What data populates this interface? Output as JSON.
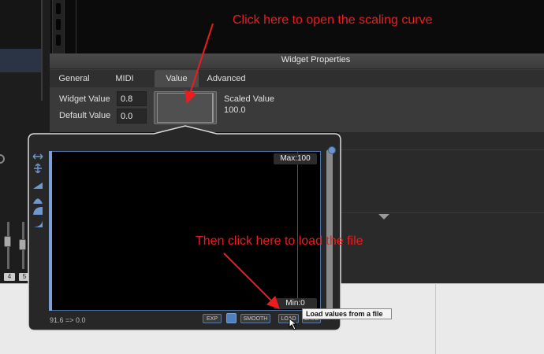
{
  "annotations": {
    "top": "Click here to open the scaling curve",
    "middle": "Then click here to load the file"
  },
  "widget_properties": {
    "title": "Widget Properties",
    "tabs": [
      {
        "label": "General"
      },
      {
        "label": "MIDI"
      },
      {
        "label": "Value",
        "active": true
      },
      {
        "label": "Advanced"
      }
    ],
    "widget_value_label": "Widget Value",
    "widget_value": "0.8",
    "default_value_label": "Default Value",
    "default_value": "0.0",
    "scaled_value_label": "Scaled Value",
    "scaled_value": "100.0"
  },
  "curve_editor": {
    "max_label": "Max:100",
    "min_label": "Min:0",
    "status": "91.6 => 0.0",
    "buttons": {
      "exp": "EXP",
      "smooth": "SMOOTH",
      "load": "LOAD",
      "save": "SAVE"
    },
    "tooltip": "Load values from a file"
  },
  "background": {
    "badges": [
      "4",
      "5"
    ]
  },
  "colors": {
    "annotation": "#ee1c1c",
    "accent_blue": "#4f7fc0",
    "curve_border": "#4a72a8"
  }
}
